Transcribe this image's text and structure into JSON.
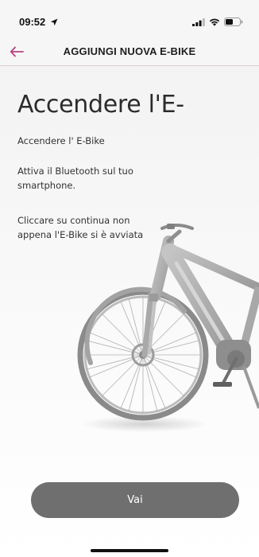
{
  "status_bar": {
    "time": "09:52"
  },
  "header": {
    "title": "AGGIUNGI NUOVA E-BIKE"
  },
  "main": {
    "title": "Accendere l'E-",
    "step_label": "Accendere l' E-Bike",
    "bluetooth_instruction": "Attiva il Bluetooth sul tuo smartphone.",
    "continue_instruction": "Cliccare su continua non appena l'E-Bike si è avviata"
  },
  "actions": {
    "go_label": "Vai"
  },
  "colors": {
    "accent": "#b8437d",
    "button": "#6f6f6f",
    "header_divider": "#e4c9d9"
  },
  "icons": [
    "location-arrow-icon",
    "signal-icon",
    "wifi-icon",
    "battery-icon",
    "back-arrow-icon"
  ]
}
